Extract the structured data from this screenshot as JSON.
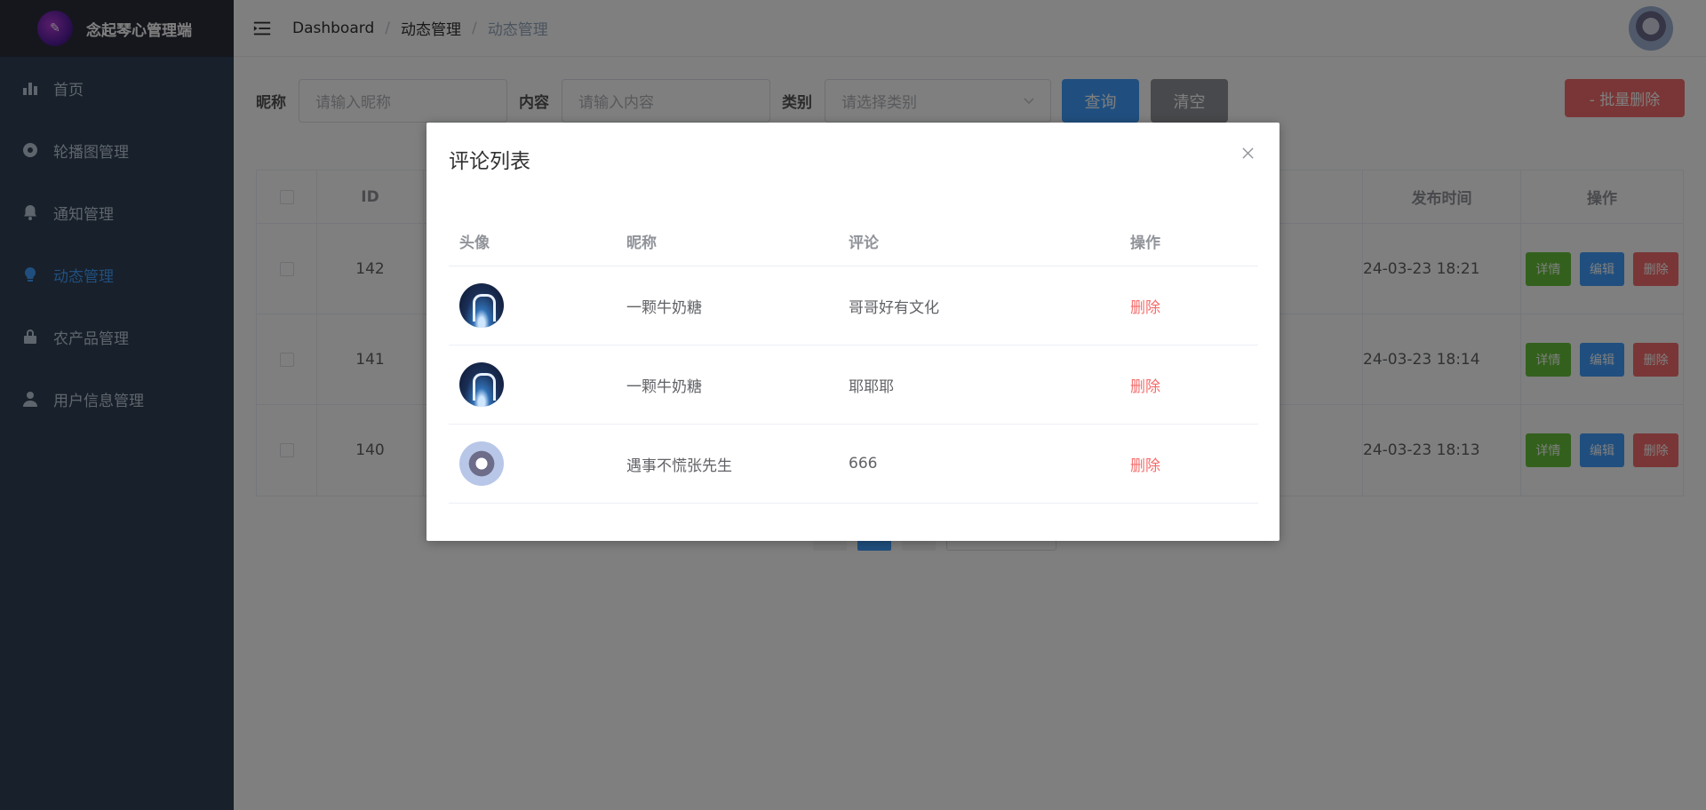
{
  "app": {
    "logo_title": "念起琴心管理端"
  },
  "sidebar": {
    "items": [
      {
        "label": "首页",
        "icon": "bar-chart-icon"
      },
      {
        "label": "轮播图管理",
        "icon": "target-icon"
      },
      {
        "label": "通知管理",
        "icon": "bell-icon"
      },
      {
        "label": "动态管理",
        "icon": "bulb-icon",
        "active": true
      },
      {
        "label": "农产品管理",
        "icon": "lock-icon"
      },
      {
        "label": "用户信息管理",
        "icon": "user-icon"
      }
    ]
  },
  "header": {
    "breadcrumb": [
      "Dashboard",
      "动态管理",
      "动态管理"
    ],
    "separator": "/"
  },
  "filters": {
    "nickname_label": "昵称",
    "nickname_placeholder": "请输入昵称",
    "content_label": "内容",
    "content_placeholder": "请输入内容",
    "category_label": "类别",
    "category_placeholder": "请选择类别",
    "query_label": "查询",
    "clear_label": "清空",
    "bulk_delete_label": "- 批量删除"
  },
  "main_table": {
    "headers": {
      "id": "ID",
      "time": "发布时间",
      "ops": "操作"
    },
    "rows": [
      {
        "id": "142",
        "time": "24-03-23 18:21"
      },
      {
        "id": "141",
        "time": "24-03-23 18:14"
      },
      {
        "id": "140",
        "time": "24-03-23 18:13"
      }
    ],
    "op_labels": {
      "detail": "详情",
      "edit": "编辑",
      "delete": "删除"
    }
  },
  "dialog": {
    "title": "评论列表",
    "headers": {
      "avatar": "头像",
      "nickname": "昵称",
      "comment": "评论",
      "ops": "操作"
    },
    "rows": [
      {
        "nickname": "一颗牛奶糖",
        "comment": "哥哥好有文化",
        "action": "删除",
        "avatar": "blue"
      },
      {
        "nickname": "一颗牛奶糖",
        "comment": "耶耶耶",
        "action": "删除",
        "avatar": "blue"
      },
      {
        "nickname": "遇事不慌张先生",
        "comment": "666",
        "action": "删除",
        "avatar": "cat"
      }
    ]
  },
  "colors": {
    "sidebar_bg": "#304156",
    "accent": "#409eff",
    "danger": "#f56c6c",
    "success": "#67c23a"
  }
}
